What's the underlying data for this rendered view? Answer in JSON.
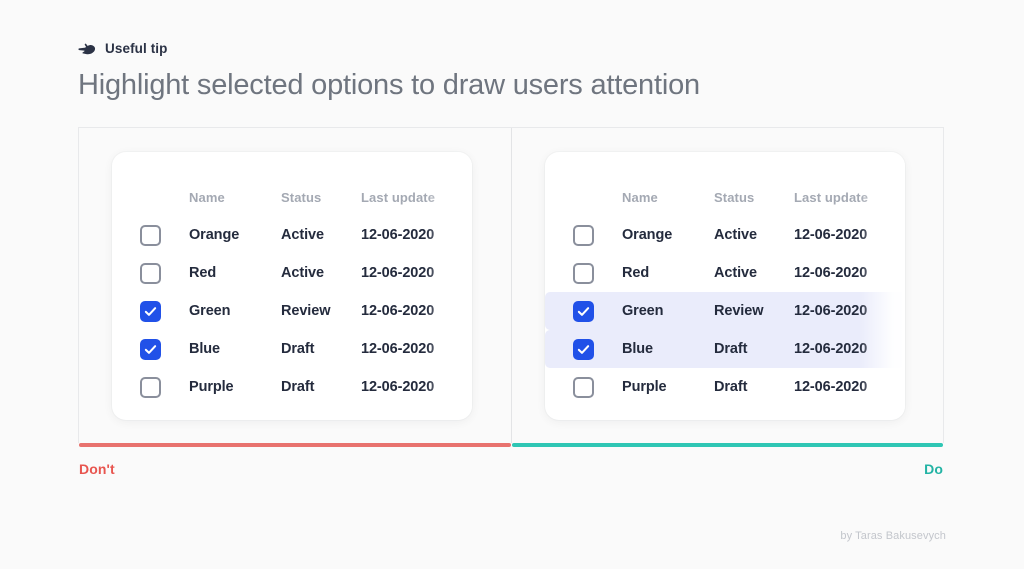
{
  "header": {
    "tip_icon": "pointing-hand-icon",
    "tip_label": "Useful tip",
    "title": "Highlight selected options to draw users attention"
  },
  "table": {
    "columns": [
      "Name",
      "Status",
      "Last update"
    ],
    "rows": [
      {
        "name": "Orange",
        "status": "Active",
        "last_update": "12-06-2020",
        "checked": false
      },
      {
        "name": "Red",
        "status": "Active",
        "last_update": "12-06-2020",
        "checked": false
      },
      {
        "name": "Green",
        "status": "Review",
        "last_update": "12-06-2020",
        "checked": true
      },
      {
        "name": "Blue",
        "status": "Draft",
        "last_update": "12-06-2020",
        "checked": true
      },
      {
        "name": "Purple",
        "status": "Draft",
        "last_update": "12-06-2020",
        "checked": false
      }
    ]
  },
  "panels": {
    "dont": {
      "caption": "Don't",
      "accent_color": "#E8554F",
      "bar_color": "#E8726E",
      "highlight_rows": false
    },
    "do": {
      "caption": "Do",
      "accent_color": "#22B3A4",
      "bar_color": "#2FC6B4",
      "highlight_rows": true,
      "highlight_color": "#EAECFB"
    }
  },
  "checkbox": {
    "checked_color": "#2151E8",
    "unchecked_border_color": "#8A8F9C",
    "check_icon": "checkmark-icon"
  },
  "credit": "by Taras Bakusevych"
}
